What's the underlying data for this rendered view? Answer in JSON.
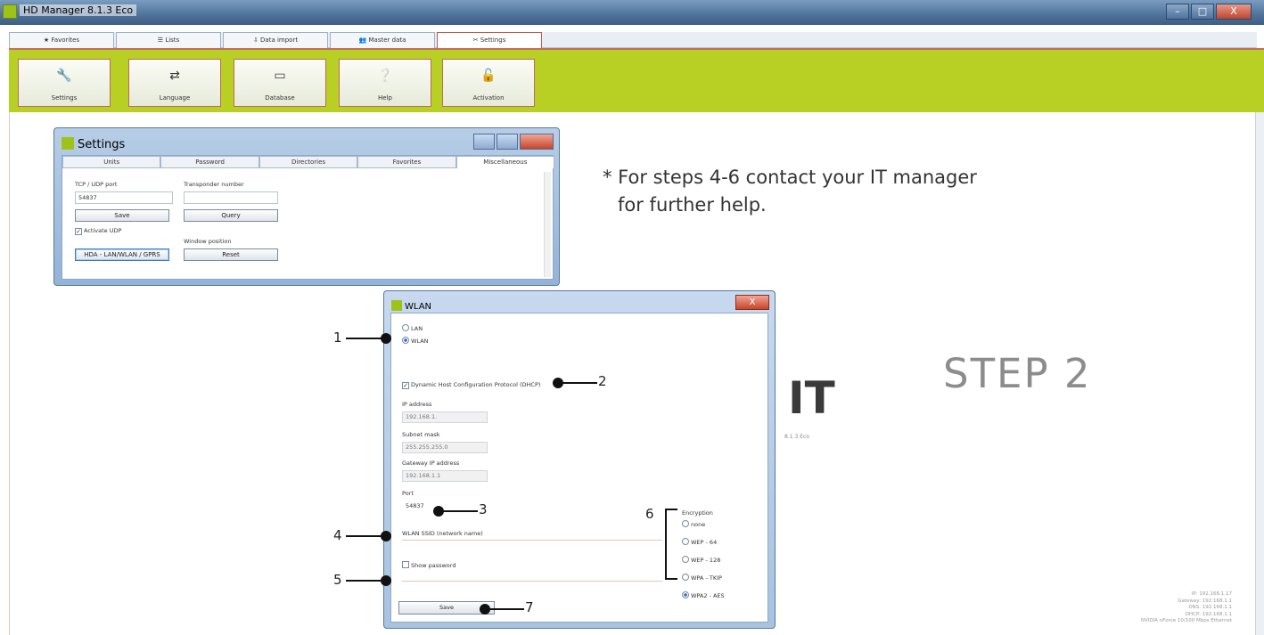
{
  "app": {
    "title": "HD Manager 8.1.3 Eco",
    "window_controls": [
      "–",
      "□",
      "X"
    ]
  },
  "tabs": [
    {
      "label": "Favorites",
      "icon": "star-icon"
    },
    {
      "label": "Lists",
      "icon": "list-icon"
    },
    {
      "label": "Data import",
      "icon": "import-icon"
    },
    {
      "label": "Master data",
      "icon": "users-icon"
    },
    {
      "label": "Settings",
      "icon": "settings-icon",
      "active": true
    }
  ],
  "ribbon": [
    {
      "label": "Settings",
      "icon": "wrench-icon"
    },
    {
      "label": "Language",
      "icon": "language-icon"
    },
    {
      "label": "Database",
      "icon": "database-icon"
    },
    {
      "label": "Help",
      "icon": "help-icon"
    },
    {
      "label": "Activation",
      "icon": "unlock-icon"
    }
  ],
  "settings_dialog": {
    "title": "Settings",
    "tabs": [
      "Units",
      "Password",
      "Directories",
      "Favorites",
      "Miscellaneous"
    ],
    "tcp_label": "TCP / UDP port",
    "tcp_value": "54837",
    "transponder_label": "Transponder number",
    "save": "Save",
    "query": "Query",
    "activate_udp": "Activate UDP",
    "window_position_label": "Window position",
    "hda_button": "HDA - LAN/WLAN / GPRS",
    "reset": "Reset"
  },
  "note": {
    "line1": "* For steps 4-6 contact your IT manager",
    "line2": "for further help."
  },
  "step_label": "STEP 2",
  "background": {
    "logo_fragment": "IT",
    "version": "8.1.3 Eco",
    "network_info": [
      "IP: 192.168.1.17",
      "Gateway: 192.168.1.1",
      "DNS: 192.168.1.1",
      "DHCP: 192.168.1.1",
      "NVIDIA nForce 10/100 Mbps Ethernet"
    ]
  },
  "wlan_dialog": {
    "title": "WLAN",
    "close": "X",
    "lan": "LAN",
    "wlan": "WLAN",
    "dhcp": "Dynamic Host Configuration Protocol (DHCP)",
    "ip_label": "IP address",
    "ip_value": "192.168.1.",
    "subnet_label": "Subnet mask",
    "subnet_value": "255.255.255.0",
    "gateway_label": "Gateway IP address",
    "gateway_value": "192.168.1.1",
    "port_label": "Port",
    "port_value": "54837",
    "ssid_label": "WLAN SSID (network name)",
    "show_password": "Show password",
    "encryption_label": "Encryption",
    "encryption_options": [
      "none",
      "WEP - 64",
      "WEP - 128",
      "WPA - TKIP",
      "WPA2 - AES"
    ],
    "encryption_selected": "WPA2 - AES",
    "save": "Save"
  },
  "callouts": [
    "1",
    "2",
    "3",
    "4",
    "5",
    "6",
    "7"
  ]
}
